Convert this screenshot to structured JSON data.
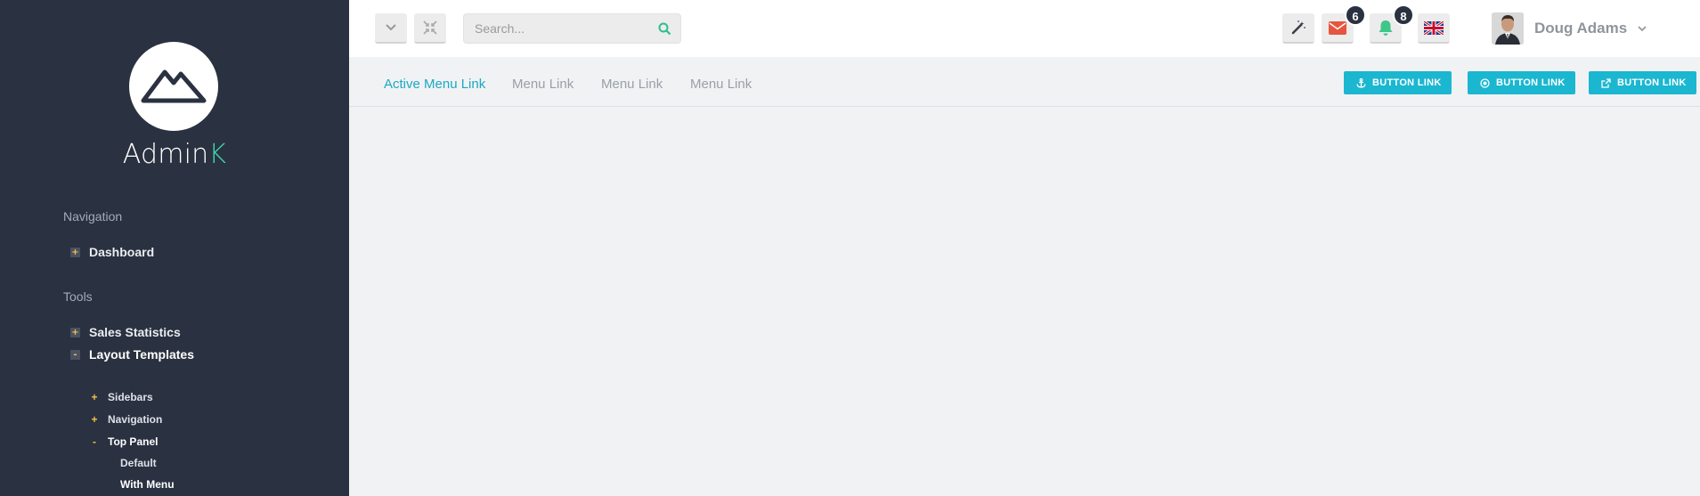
{
  "brand": {
    "name_main": "Admin",
    "name_accent": "K"
  },
  "sidebar": {
    "sections": [
      {
        "title": "Navigation"
      },
      {
        "title": "Tools"
      }
    ],
    "items": [
      {
        "label": "Dashboard",
        "toggle": "+"
      },
      {
        "label": "Sales Statistics",
        "toggle": "+"
      },
      {
        "label": "Layout Templates",
        "toggle": "-"
      }
    ],
    "subitems": [
      {
        "label": "Sidebars",
        "toggle": "+"
      },
      {
        "label": "Navigation",
        "toggle": "+"
      },
      {
        "label": "Top Panel",
        "toggle": "-"
      }
    ],
    "subsubitems": [
      {
        "label": "Default"
      },
      {
        "label": "With Menu"
      }
    ]
  },
  "header": {
    "search": {
      "placeholder": "Search..."
    },
    "mail_badge": "6",
    "notification_badge": "8",
    "user": {
      "name": "Doug Adams"
    }
  },
  "subbar": {
    "links": [
      {
        "label": "Active Menu Link"
      },
      {
        "label": "Menu Link"
      },
      {
        "label": "Menu Link"
      },
      {
        "label": "Menu Link"
      }
    ],
    "buttons": [
      {
        "label": "BUTTON LINK",
        "icon": "anchor-icon"
      },
      {
        "label": "BUTTON LINK",
        "icon": "dot-circle-icon"
      },
      {
        "label": "BUTTON LINK",
        "icon": "external-link-icon"
      }
    ]
  },
  "colors": {
    "sidebar_bg": "#2a3140",
    "accent": "#40d6b0",
    "button": "#1bb7d0",
    "active_link": "#1ba8c4",
    "mail_icon": "#e7553e",
    "bell_icon": "#3fc689"
  }
}
